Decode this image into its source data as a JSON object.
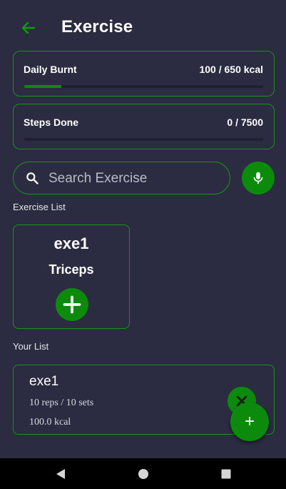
{
  "header": {
    "title": "Exercise",
    "back_icon": "arrow-back-icon"
  },
  "daily_burnt": {
    "label": "Daily Burnt",
    "value": "100 / 650 kcal",
    "progress": 0.154
  },
  "steps": {
    "label": "Steps Done",
    "value": "0 / 7500",
    "progress": 0
  },
  "search": {
    "placeholder": "Search Exercise",
    "value": "",
    "icon": "search-icon",
    "mic_icon": "mic-icon"
  },
  "exercise_list": {
    "title": "Exercise List",
    "items": [
      {
        "name": "exe1",
        "muscle": "Triceps",
        "add_icon": "plus-icon"
      }
    ]
  },
  "your_list": {
    "title": "Your List",
    "items": [
      {
        "name": "exe1",
        "reps": "10 reps / 10 sets",
        "kcal": "100.0 kcal",
        "remove_icon": "close-icon"
      }
    ]
  },
  "fab": {
    "label": "+"
  },
  "colors": {
    "background": "#2b2c42",
    "accent": "#0c8a0c",
    "border": "#1f8f1f"
  },
  "navigation": {
    "back": "back-triangle-icon",
    "home": "home-circle-icon",
    "recents": "recents-square-icon"
  }
}
